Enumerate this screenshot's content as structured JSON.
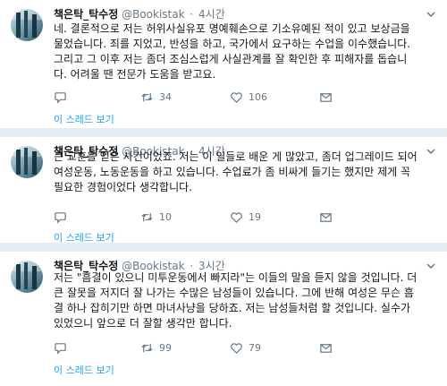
{
  "tweets": [
    {
      "name": "책은탁_탁수정",
      "handle": "@Bookistak",
      "time": "4시간",
      "lines": [
        "네. 결론적으로 저는 허위사실유포 명예훼손으로 기소유예된 적이 있고 보상금을",
        "물었습니다. 죄를 지었고, 반성을 하고, 국가에서 요구하는 수업을 이수했습니다.",
        "그리고 그 이후 저는 좀더 조심스럽게 사실관계를 잘 확인한 후 피해자를 돕습니",
        "다. 어려울 땐 전문가 도움을 받고요."
      ],
      "retweets": "34",
      "likes": "106",
      "thread_link": "이 스레드 보기"
    },
    {
      "name": "책은탁_탁수정",
      "handle": "@Bookistak",
      "time": "4시간",
      "lines": [
        "큰 교훈을 얻은 사건이었죠. 저는 이 일들로 배운 게 많았고, 좀더 업그레이드 되어",
        "여성운동, 노동운동을 하고 있습니다. 수업료가 좀 비싸게 들기는 했지만 제게 꼭",
        "필요한 경험이었다 생각합니다."
      ],
      "retweets": "10",
      "likes": "19",
      "thread_link": "이 스레드 보기"
    },
    {
      "name": "책은탁_탁수정",
      "handle": "@Bookistak",
      "time": "3시간",
      "lines": [
        "저는 \"흠결이 있으니 미투운동에서 빠지라\"는 이들의 말을 듣지 않을 것입니다. 더",
        "큰 잘못을 저지더 잘 나가는 수많은 남성들이 있습니다. 그에 반해 여성은 무슨 흠",
        "결 하나 잡히기만 하면 마녀사냥을 당하죠. 저는 남성들처럼 할 것입니다. 실수가",
        "있었으니 앞으로 더 잘할 생각만 합니다."
      ],
      "retweets": "99",
      "likes": "79",
      "thread_link": "이 스레드 보기"
    }
  ],
  "colors": {
    "text": "#14171a",
    "muted": "#657786",
    "link": "#1da1f2",
    "divider": "#e6ecf0"
  },
  "icons": [
    "chevron-down-icon",
    "reply-icon",
    "retweet-icon",
    "like-icon",
    "message-icon"
  ]
}
